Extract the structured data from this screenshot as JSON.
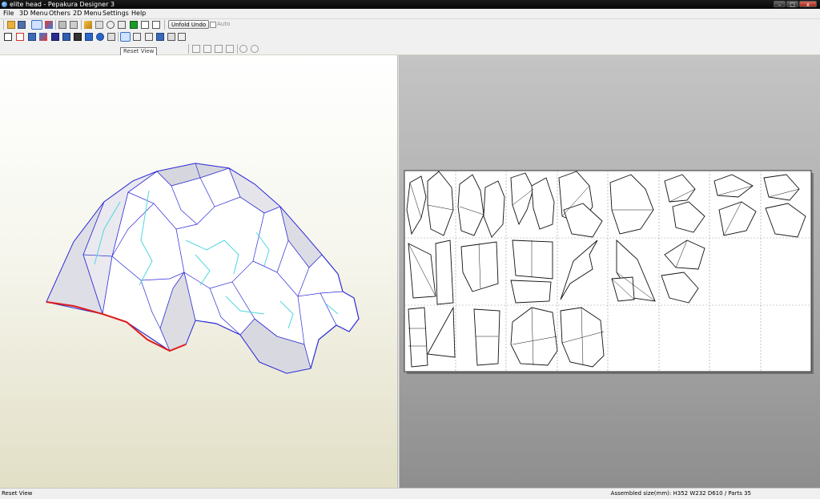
{
  "window": {
    "title": "elite head - Pepakura Designer 3",
    "minimize_glyph": "–",
    "maximize_glyph": "□",
    "close_glyph": "x"
  },
  "menu": {
    "items": [
      "File",
      "3D Menu",
      "Others",
      "2D Menu",
      "Settings",
      "Help"
    ]
  },
  "toolbar": {
    "unfold_undo_label": "Unfold Undo",
    "auto_label": "Auto",
    "auto_checked": false
  },
  "tooltip": {
    "text": "Reset View"
  },
  "status": {
    "left": "Reset View",
    "right": "Assembled size(mm): H352 W232 D610 / Parts 35"
  },
  "colors": {
    "model_edge": "#2b2bd6",
    "fold_line": "#4fd7e0",
    "cut_edge": "#e01b1b",
    "accent_green": "#1a9a2a"
  },
  "icons": [
    "select-icon",
    "rotate-icon",
    "image-icon",
    "texture-icon",
    "open-icon",
    "save-icon",
    "light-icon",
    "cube-icon",
    "join-icon",
    "split-icon",
    "pencil-icon",
    "trash-icon",
    "anchor-icon",
    "flap-icon",
    "sheet-icon",
    "green-part-icon",
    "window-icon",
    "window2-icon",
    "pointer-icon",
    "move-icon",
    "face-icon",
    "lock-icon",
    "group-icon",
    "arrow-icon",
    "undo-icon",
    "fit-icon",
    "reset-view-icon",
    "numbers-icon",
    "expand-icon",
    "image2-icon",
    "print-icon",
    "print-preview-icon",
    "align-left-icon",
    "align-center-icon",
    "align-right-icon",
    "align-top-icon",
    "rotate-left-icon",
    "rotate-right-icon"
  ]
}
